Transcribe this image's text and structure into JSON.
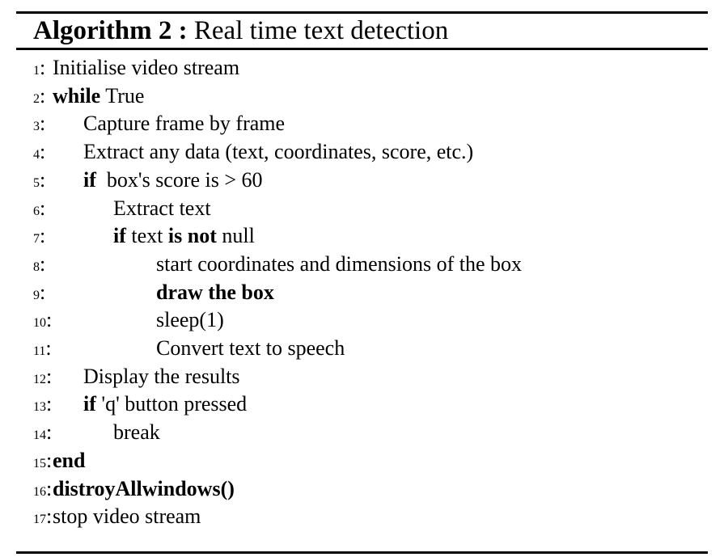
{
  "algorithm": {
    "label": "Algorithm 2 :",
    "title": "Real time text detection",
    "lines": [
      {
        "num": "1",
        "indent": 0,
        "parts": [
          {
            "t": "Initialise video stream",
            "b": false
          }
        ]
      },
      {
        "num": "2",
        "indent": 0,
        "parts": [
          {
            "t": "while",
            "b": true
          },
          {
            "t": " True",
            "b": false
          }
        ]
      },
      {
        "num": "3",
        "indent": 1,
        "parts": [
          {
            "t": "Capture frame by frame",
            "b": false
          }
        ]
      },
      {
        "num": "4",
        "indent": 1,
        "parts": [
          {
            "t": "Extract any data (text, coordinates, score, etc.)",
            "b": false
          }
        ]
      },
      {
        "num": "5",
        "indent": 1,
        "parts": [
          {
            "t": "if",
            "b": true
          },
          {
            "t": "  box's score is > 60",
            "b": false
          }
        ]
      },
      {
        "num": "6",
        "indent": 2,
        "parts": [
          {
            "t": "Extract text",
            "b": false
          }
        ]
      },
      {
        "num": "7",
        "indent": 2,
        "parts": [
          {
            "t": "if",
            "b": true
          },
          {
            "t": " text ",
            "b": false
          },
          {
            "t": "is not",
            "b": true
          },
          {
            "t": " null",
            "b": false
          }
        ]
      },
      {
        "num": "8",
        "indent": 3,
        "parts": [
          {
            "t": "start coordinates and dimensions of the box",
            "b": false
          }
        ]
      },
      {
        "num": "9",
        "indent": 3,
        "parts": [
          {
            "t": "draw the box",
            "b": true
          }
        ]
      },
      {
        "num": "10",
        "indent": 3,
        "parts": [
          {
            "t": "sleep(1)",
            "b": false
          }
        ]
      },
      {
        "num": "11",
        "indent": 3,
        "parts": [
          {
            "t": "Convert text to speech",
            "b": false
          }
        ]
      },
      {
        "num": "12",
        "indent": 1,
        "parts": [
          {
            "t": "Display the results",
            "b": false
          }
        ]
      },
      {
        "num": "13",
        "indent": 1,
        "parts": [
          {
            "t": "if",
            "b": true
          },
          {
            "t": " 'q' button pressed",
            "b": false
          }
        ]
      },
      {
        "num": "14",
        "indent": 2,
        "parts": [
          {
            "t": "break",
            "b": false
          }
        ]
      },
      {
        "num": "15",
        "indent": 0,
        "parts": [
          {
            "t": "end",
            "b": true
          }
        ]
      },
      {
        "num": "16",
        "indent": 0,
        "parts": [
          {
            "t": "distroyAllwindows()",
            "b": true
          }
        ]
      },
      {
        "num": "17",
        "indent": 0,
        "parts": [
          {
            "t": "stop video stream",
            "b": false
          }
        ]
      }
    ]
  }
}
